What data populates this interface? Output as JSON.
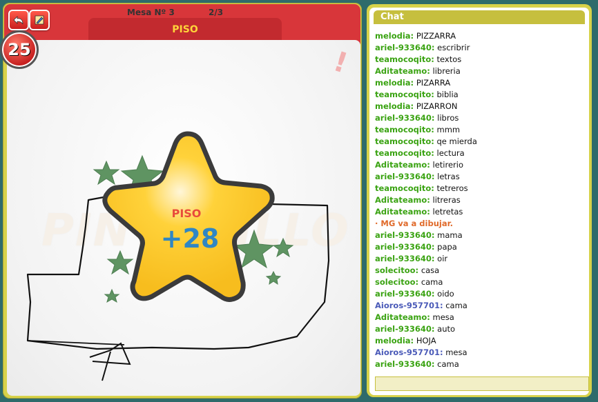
{
  "game": {
    "table_label": "Mesa Nº 3",
    "round_label": "2/3",
    "word": "PISO",
    "timer": "25",
    "watermark": "PINTURILLO",
    "toolbar": {
      "back_icon": "back-arrow-icon",
      "edit_icon": "pencil-icon"
    },
    "alert_icon": "!",
    "result": {
      "word": "PISO",
      "points": "+28"
    }
  },
  "chat": {
    "title": "Chat",
    "input_value": "",
    "colors": {
      "green": "#3aa312",
      "blue": "#4a5ab8",
      "system": "#e06a2a"
    },
    "messages": [
      {
        "nick": "melodia:",
        "text": "PIZZARRA",
        "color": "green"
      },
      {
        "nick": "ariel-933640:",
        "text": "escribrir",
        "color": "green"
      },
      {
        "nick": "teamocoqito:",
        "text": "textos",
        "color": "green"
      },
      {
        "nick": "Aditateamo:",
        "text": "libreria",
        "color": "green"
      },
      {
        "nick": "melodia:",
        "text": "PIZARRA",
        "color": "green"
      },
      {
        "nick": "teamocoqito:",
        "text": "biblia",
        "color": "green"
      },
      {
        "nick": "melodia:",
        "text": "PIZARRON",
        "color": "green"
      },
      {
        "nick": "ariel-933640:",
        "text": "libros",
        "color": "green"
      },
      {
        "nick": "teamocoqito:",
        "text": "mmm",
        "color": "green"
      },
      {
        "nick": "teamocoqito:",
        "text": "qe mierda",
        "color": "green"
      },
      {
        "nick": "teamocoqito:",
        "text": "lectura",
        "color": "green"
      },
      {
        "nick": "Aditateamo:",
        "text": "letirerio",
        "color": "green"
      },
      {
        "nick": "ariel-933640:",
        "text": "letras",
        "color": "green"
      },
      {
        "nick": "teamocoqito:",
        "text": "tetreros",
        "color": "green"
      },
      {
        "nick": "Aditateamo:",
        "text": "litreras",
        "color": "green"
      },
      {
        "nick": "Aditateamo:",
        "text": "letretas",
        "color": "green"
      },
      {
        "nick": "· MG va a dibujar.",
        "text": "",
        "color": "system"
      },
      {
        "nick": "ariel-933640:",
        "text": "mama",
        "color": "green"
      },
      {
        "nick": "ariel-933640:",
        "text": "papa",
        "color": "green"
      },
      {
        "nick": "ariel-933640:",
        "text": "oir",
        "color": "green"
      },
      {
        "nick": "solecitoo:",
        "text": "casa",
        "color": "green"
      },
      {
        "nick": "solecitoo:",
        "text": "cama",
        "color": "green"
      },
      {
        "nick": "ariel-933640:",
        "text": "oido",
        "color": "green"
      },
      {
        "nick": "Aioros-957701:",
        "text": "cama",
        "color": "blue"
      },
      {
        "nick": "Aditateamo:",
        "text": "mesa",
        "color": "green"
      },
      {
        "nick": "ariel-933640:",
        "text": "auto",
        "color": "green"
      },
      {
        "nick": "melodia:",
        "text": "HOJA",
        "color": "green"
      },
      {
        "nick": "Aioros-957701:",
        "text": "mesa",
        "color": "blue"
      },
      {
        "nick": "ariel-933640:",
        "text": "cama",
        "color": "green"
      }
    ]
  }
}
